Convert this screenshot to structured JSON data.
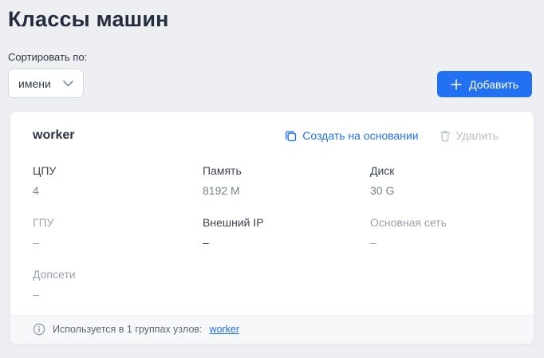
{
  "page": {
    "title": "Классы машин",
    "sort_label": "Сортировать по:",
    "sort_value": "имени",
    "add_button": "Добавить"
  },
  "card": {
    "name": "worker",
    "actions": {
      "create_from": "Создать на основании",
      "delete": "Удалить"
    },
    "fields": [
      {
        "label": "ЦПУ",
        "value": "4"
      },
      {
        "label": "Память",
        "value": "8192 M"
      },
      {
        "label": "Диск",
        "value": "30 G"
      },
      {
        "label": "ГПУ",
        "value": "–"
      },
      {
        "label": "Внешний IP",
        "value": "–"
      },
      {
        "label": "Основная сеть",
        "value": "–"
      },
      {
        "label": "Допсети",
        "value": "–"
      }
    ],
    "footer": {
      "text": "Используется в 1 группах узлов:",
      "link": "worker"
    }
  },
  "icons": {
    "chevron": "chevron-down-icon",
    "plus": "plus-icon",
    "copy": "copy-icon",
    "trash": "trash-icon",
    "info": "info-icon"
  },
  "colors": {
    "accent": "#2171f2",
    "disabled": "#b9c0cc",
    "background": "#edeff3",
    "card": "#ffffff",
    "text_dark": "#3b4251",
    "text_muted": "#9aa2b0"
  }
}
